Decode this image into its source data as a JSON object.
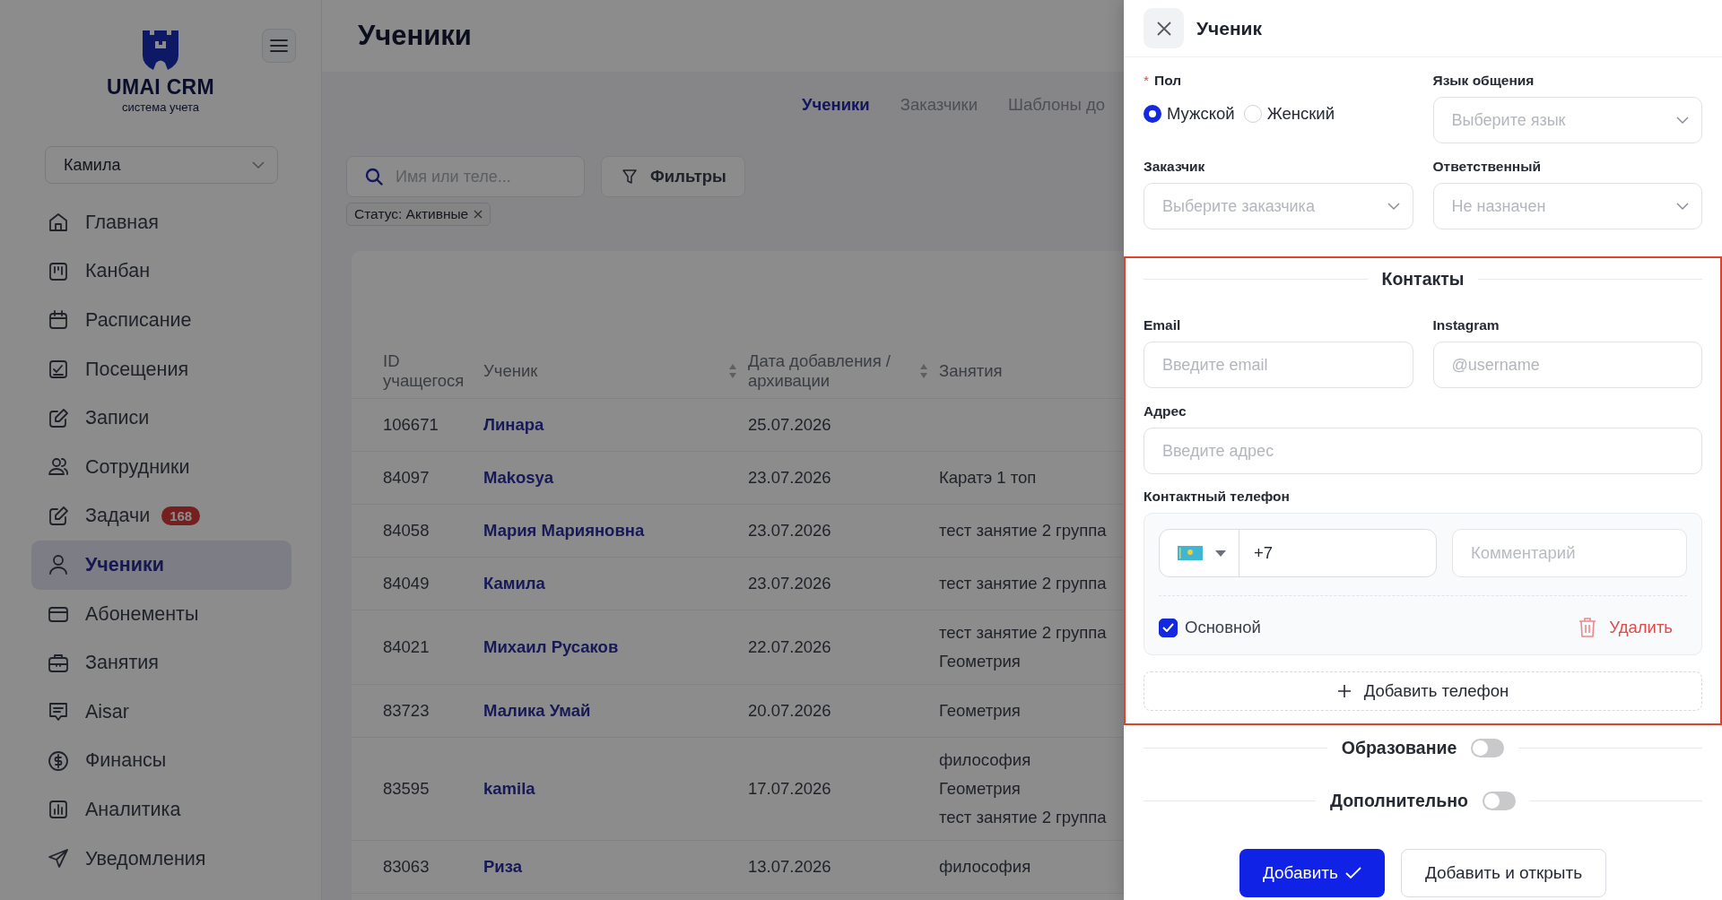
{
  "sidebar": {
    "logo_title": "UMAI CRM",
    "logo_subtitle": "система учета",
    "branch": "Камила",
    "items": [
      {
        "label": "Главная",
        "selected": false
      },
      {
        "label": "Канбан",
        "selected": false
      },
      {
        "label": "Расписание",
        "selected": false
      },
      {
        "label": "Посещения",
        "selected": false
      },
      {
        "label": "Записи",
        "selected": false
      },
      {
        "label": "Сотрудники",
        "selected": false
      },
      {
        "label": "Задачи",
        "badge": "168",
        "selected": false
      },
      {
        "label": "Ученики",
        "selected": true
      },
      {
        "label": "Абонементы",
        "selected": false
      },
      {
        "label": "Занятия",
        "selected": false
      },
      {
        "label": "Aisar",
        "selected": false
      },
      {
        "label": "Финансы",
        "selected": false
      },
      {
        "label": "Аналитика",
        "selected": false
      },
      {
        "label": "Уведомления",
        "selected": false
      }
    ]
  },
  "page": {
    "title": "Ученики",
    "tabs": [
      {
        "label": "Ученики",
        "selected": true
      },
      {
        "label": "Заказчики",
        "selected": false
      },
      {
        "label": "Шаблоны до",
        "selected": false
      }
    ],
    "search": {
      "placeholder": "Имя или теле..."
    },
    "filters_button": "Фильтры",
    "filter_chips": [
      {
        "label": "Статус: Активные"
      }
    ],
    "table": {
      "columns": [
        {
          "label": "ID учащегося",
          "sortable": false
        },
        {
          "label": "Ученик",
          "sortable": true
        },
        {
          "label": "Дата добавления / архивации",
          "sortable": true
        },
        {
          "label": "Занятия",
          "sortable": false
        }
      ],
      "rows": [
        {
          "id": "106671",
          "name": "Линара",
          "date": "25.07.2026",
          "classes": []
        },
        {
          "id": "84097",
          "name": "Makosya",
          "date": "23.07.2026",
          "classes": [
            "Каратэ 1 топ"
          ]
        },
        {
          "id": "84058",
          "name": "Мария Марияновна",
          "date": "23.07.2026",
          "classes": [
            "тест занятие 2 группа"
          ]
        },
        {
          "id": "84049",
          "name": "Камила",
          "date": "23.07.2026",
          "classes": [
            "тест занятие 2 группа"
          ]
        },
        {
          "id": "84021",
          "name": "Михаил Русаков",
          "date": "22.07.2026",
          "classes": [
            "тест занятие 2 группа",
            "Геометрия"
          ]
        },
        {
          "id": "83723",
          "name": "Малика Умай",
          "date": "20.07.2026",
          "classes": [
            "Геометрия"
          ]
        },
        {
          "id": "83595",
          "name": "kamila",
          "date": "17.07.2026",
          "classes": [
            "философия",
            "Геометрия",
            "тест занятие 2 группа"
          ]
        },
        {
          "id": "83063",
          "name": "Риза",
          "date": "13.07.2026",
          "classes": [
            "философия"
          ]
        }
      ]
    }
  },
  "drawer": {
    "title": "Ученик",
    "gender": {
      "label": "Пол",
      "required_mark": "*",
      "options": [
        {
          "label": "Мужской",
          "selected": true
        },
        {
          "label": "Женский",
          "selected": false
        }
      ]
    },
    "language": {
      "label": "Язык общения",
      "placeholder": "Выберите язык"
    },
    "customer": {
      "label": "Заказчик",
      "placeholder": "Выберите заказчика"
    },
    "responsible": {
      "label": "Ответственный",
      "placeholder": "Не назначен"
    },
    "contacts": {
      "title": "Контакты",
      "highlighted": true,
      "email": {
        "label": "Email",
        "placeholder": "Введите email"
      },
      "instagram": {
        "label": "Instagram",
        "placeholder": "@username"
      },
      "address": {
        "label": "Адрес",
        "placeholder": "Введите адрес"
      },
      "phone": {
        "label": "Контактный телефон",
        "value": "+7",
        "comment_placeholder": "Комментарий",
        "primary": {
          "label": "Основной",
          "checked": true
        },
        "delete_label": "Удалить"
      },
      "add_phone": "Добавить телефон"
    },
    "sections": [
      {
        "title": "Образование",
        "on": false
      },
      {
        "title": "Дополнительно",
        "on": false
      }
    ],
    "buttons": [
      {
        "label": "Добавить",
        "kind": "primary"
      },
      {
        "label": "Добавить и открыть",
        "kind": "secondary"
      }
    ]
  }
}
